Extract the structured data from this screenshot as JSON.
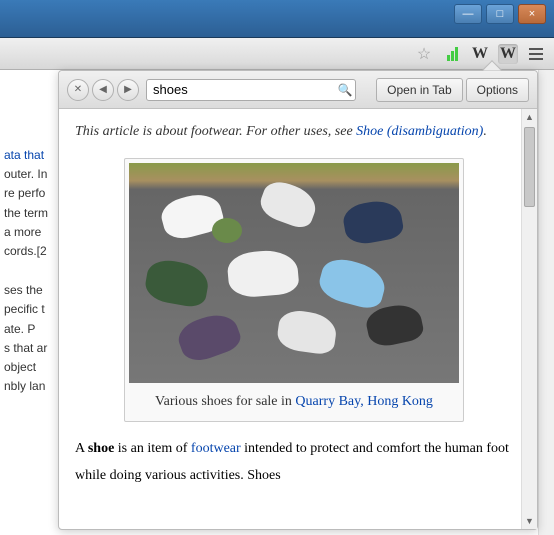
{
  "window": {
    "minimize": "—",
    "maximize": "□",
    "close": "×"
  },
  "chrome_toolbar": {
    "star": "☆",
    "wikipedia_letter": "W",
    "signal_bars": 3
  },
  "background_page": {
    "fragments": [
      "ata that",
      "outer. In",
      "re perfo",
      "the term",
      "a more",
      "cords.[2",
      "ses the",
      "pecific t",
      "ate. P",
      "s that ar",
      "object",
      "nbly lan"
    ]
  },
  "popup": {
    "toolbar": {
      "close": "✕",
      "back": "◀",
      "forward": "▶",
      "search_value": "shoes",
      "search_icon": "🔍",
      "open_tab": "Open in Tab",
      "options": "Options"
    },
    "hatnote": {
      "prefix": "This article is about footwear. For other uses, see ",
      "link": "Shoe (disambiguation)",
      "suffix": "."
    },
    "image": {
      "caption_prefix": "Various shoes for sale in ",
      "caption_link": "Quarry Bay, Hong Kong"
    },
    "body": {
      "p1_a": "A ",
      "p1_bold": "shoe",
      "p1_b": " is an item of ",
      "p1_link": "footwear",
      "p1_c": " intended to protect and comfort the human foot while doing various activities. Shoes"
    }
  }
}
